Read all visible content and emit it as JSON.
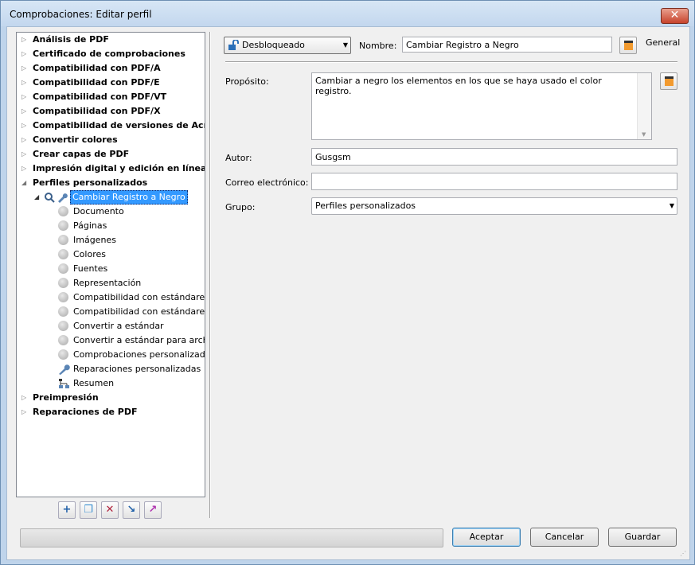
{
  "window": {
    "title": "Comprobaciones: Editar perfil",
    "close_glyph": "✕"
  },
  "tree": {
    "top_items": [
      {
        "label": "Análisis de PDF"
      },
      {
        "label": "Certificado de comprobaciones"
      },
      {
        "label": "Compatibilidad con PDF/A"
      },
      {
        "label": "Compatibilidad con PDF/E"
      },
      {
        "label": "Compatibilidad con PDF/VT"
      },
      {
        "label": "Compatibilidad con PDF/X"
      },
      {
        "label": "Compatibilidad de versiones de Acrobat/P"
      },
      {
        "label": "Convertir colores"
      },
      {
        "label": "Crear capas de PDF"
      },
      {
        "label": "Impresión digital y edición en línea"
      },
      {
        "label": "Perfiles personalizados"
      }
    ],
    "selected_profile": "Cambiar Registro a Negro",
    "children": [
      {
        "label": "Documento",
        "icon": "gray-circle-icon"
      },
      {
        "label": "Páginas",
        "icon": "gray-circle-icon"
      },
      {
        "label": "Imágenes",
        "icon": "gray-circle-icon"
      },
      {
        "label": "Colores",
        "icon": "gray-circle-icon"
      },
      {
        "label": "Fuentes",
        "icon": "gray-circle-icon"
      },
      {
        "label": "Representación",
        "icon": "gray-circle-icon"
      },
      {
        "label": "Compatibilidad con estándares",
        "icon": "gray-circle-icon"
      },
      {
        "label": "Compatibilidad con estándares p",
        "icon": "gray-circle-icon"
      },
      {
        "label": "Convertir a estándar",
        "icon": "gray-circle-icon"
      },
      {
        "label": "Convertir a estándar para archivo",
        "icon": "gray-circle-icon"
      },
      {
        "label": "Comprobaciones personalizadas",
        "icon": "gray-circle-icon"
      },
      {
        "label": "Reparaciones personalizadas",
        "icon": "wrench-icon"
      },
      {
        "label": "Resumen",
        "icon": "summary-icon"
      }
    ],
    "bottom_items": [
      {
        "label": "Preimpresión"
      },
      {
        "label": "Reparaciones de PDF"
      }
    ]
  },
  "toolbar": {
    "icons": [
      "add-icon",
      "duplicate-icon",
      "delete-icon",
      "import-icon",
      "export-icon"
    ],
    "glyphs": [
      "+",
      "❐",
      "✕",
      "↘",
      "↗"
    ]
  },
  "form": {
    "lock_value": "Desbloqueado",
    "name_label": "Nombre:",
    "name_value": "Cambiar Registro a Negro",
    "general_label": "General",
    "purpose_label": "Propósito:",
    "purpose_value": "Cambiar a negro los elementos en los que se haya usado el color registro.",
    "author_label": "Autor:",
    "author_value": "Gusgsm",
    "email_label": "Correo electrónico:",
    "email_value": "",
    "group_label": "Grupo:",
    "group_value": "Perfiles personalizados"
  },
  "buttons": {
    "accept": "Aceptar",
    "cancel": "Cancelar",
    "save": "Guardar"
  },
  "colors": {
    "selection": "#3399ff",
    "title_bar": "#c3d7ee",
    "client_bg": "#f0f0f0"
  }
}
